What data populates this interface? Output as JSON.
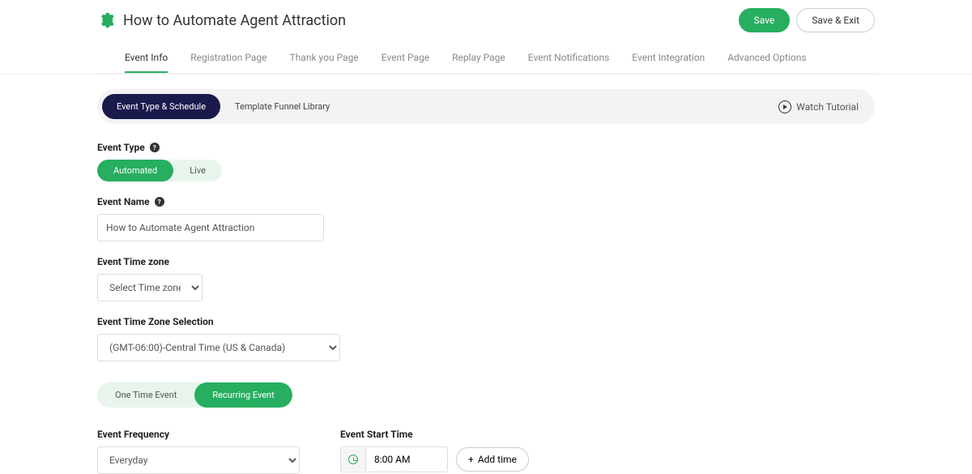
{
  "header": {
    "title": "How to Automate Agent Attraction",
    "save": "Save",
    "save_exit": "Save & Exit"
  },
  "tabs": [
    "Event Info",
    "Registration Page",
    "Thank you Page",
    "Event Page",
    "Replay Page",
    "Event Notifications",
    "Event Integration",
    "Advanced Options"
  ],
  "active_tab_index": 0,
  "sub_tabs": {
    "schedule": "Event Type & Schedule",
    "template": "Template Funnel Library",
    "watch": "Watch Tutorial"
  },
  "fields": {
    "event_type": {
      "label": "Event Type",
      "options": {
        "automated": "Automated",
        "live": "Live"
      }
    },
    "event_name": {
      "label": "Event Name",
      "value": "How to Automate Agent Attraction"
    },
    "timezone_strategy": {
      "label": "Event Time zone",
      "value": "Select Time zone"
    },
    "timezone_select": {
      "label": "Event Time Zone Selection",
      "value": "(GMT-06:00)-Central Time (US & Canada)"
    },
    "recurrence": {
      "one_time": "One Time Event",
      "recurring": "Recurring Event"
    },
    "frequency": {
      "label": "Event Frequency",
      "value": "Everyday"
    },
    "start_time": {
      "label": "Event Start Time",
      "value": "8:00 AM",
      "add_time": "Add time"
    }
  }
}
